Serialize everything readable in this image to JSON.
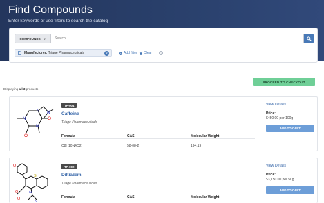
{
  "header": {
    "title": "Find Compounds",
    "subtitle": "Enter keywords or use filters to search the catalog"
  },
  "search": {
    "scope_label": "COMPOUNDS",
    "placeholder": "Search..."
  },
  "filters": {
    "chip_key": "Manufacturer:",
    "chip_value": "Triage Pharmaceuticals",
    "add_label": "Add filter",
    "clear_label": "Clear"
  },
  "results": {
    "count_prefix": "Displaying",
    "count_value": "all 3",
    "count_suffix": "products",
    "checkout_label": "PROCEED TO CHECKOUT"
  },
  "columns": {
    "formula": "Formula",
    "cas": "CAS",
    "mw": "Molecular Weight"
  },
  "products": [
    {
      "code": "TP-001",
      "name": "Caffeine",
      "manufacturer": "Triage Pharmaceuticals",
      "formula": "C8H10N4O2",
      "cas": "58-08-2",
      "mw": "194.19",
      "details_label": "View Details",
      "price_label": "Price:",
      "price": "$450.00 per 100g",
      "cart_label": "ADD TO CART"
    },
    {
      "code": "TP-002",
      "name": "Diltiazem",
      "manufacturer": "Triage Pharmaceuticals",
      "details_label": "View Details",
      "price_label": "Price:",
      "price": "$3,150.00 per 50g",
      "cart_label": "ADD TO CART"
    }
  ],
  "colors": {
    "header_bg": "#2a416d",
    "accent": "#4879b7",
    "checkout": "#6fcf97",
    "cart": "#6d9ed8",
    "name_link": "#3565a8"
  }
}
